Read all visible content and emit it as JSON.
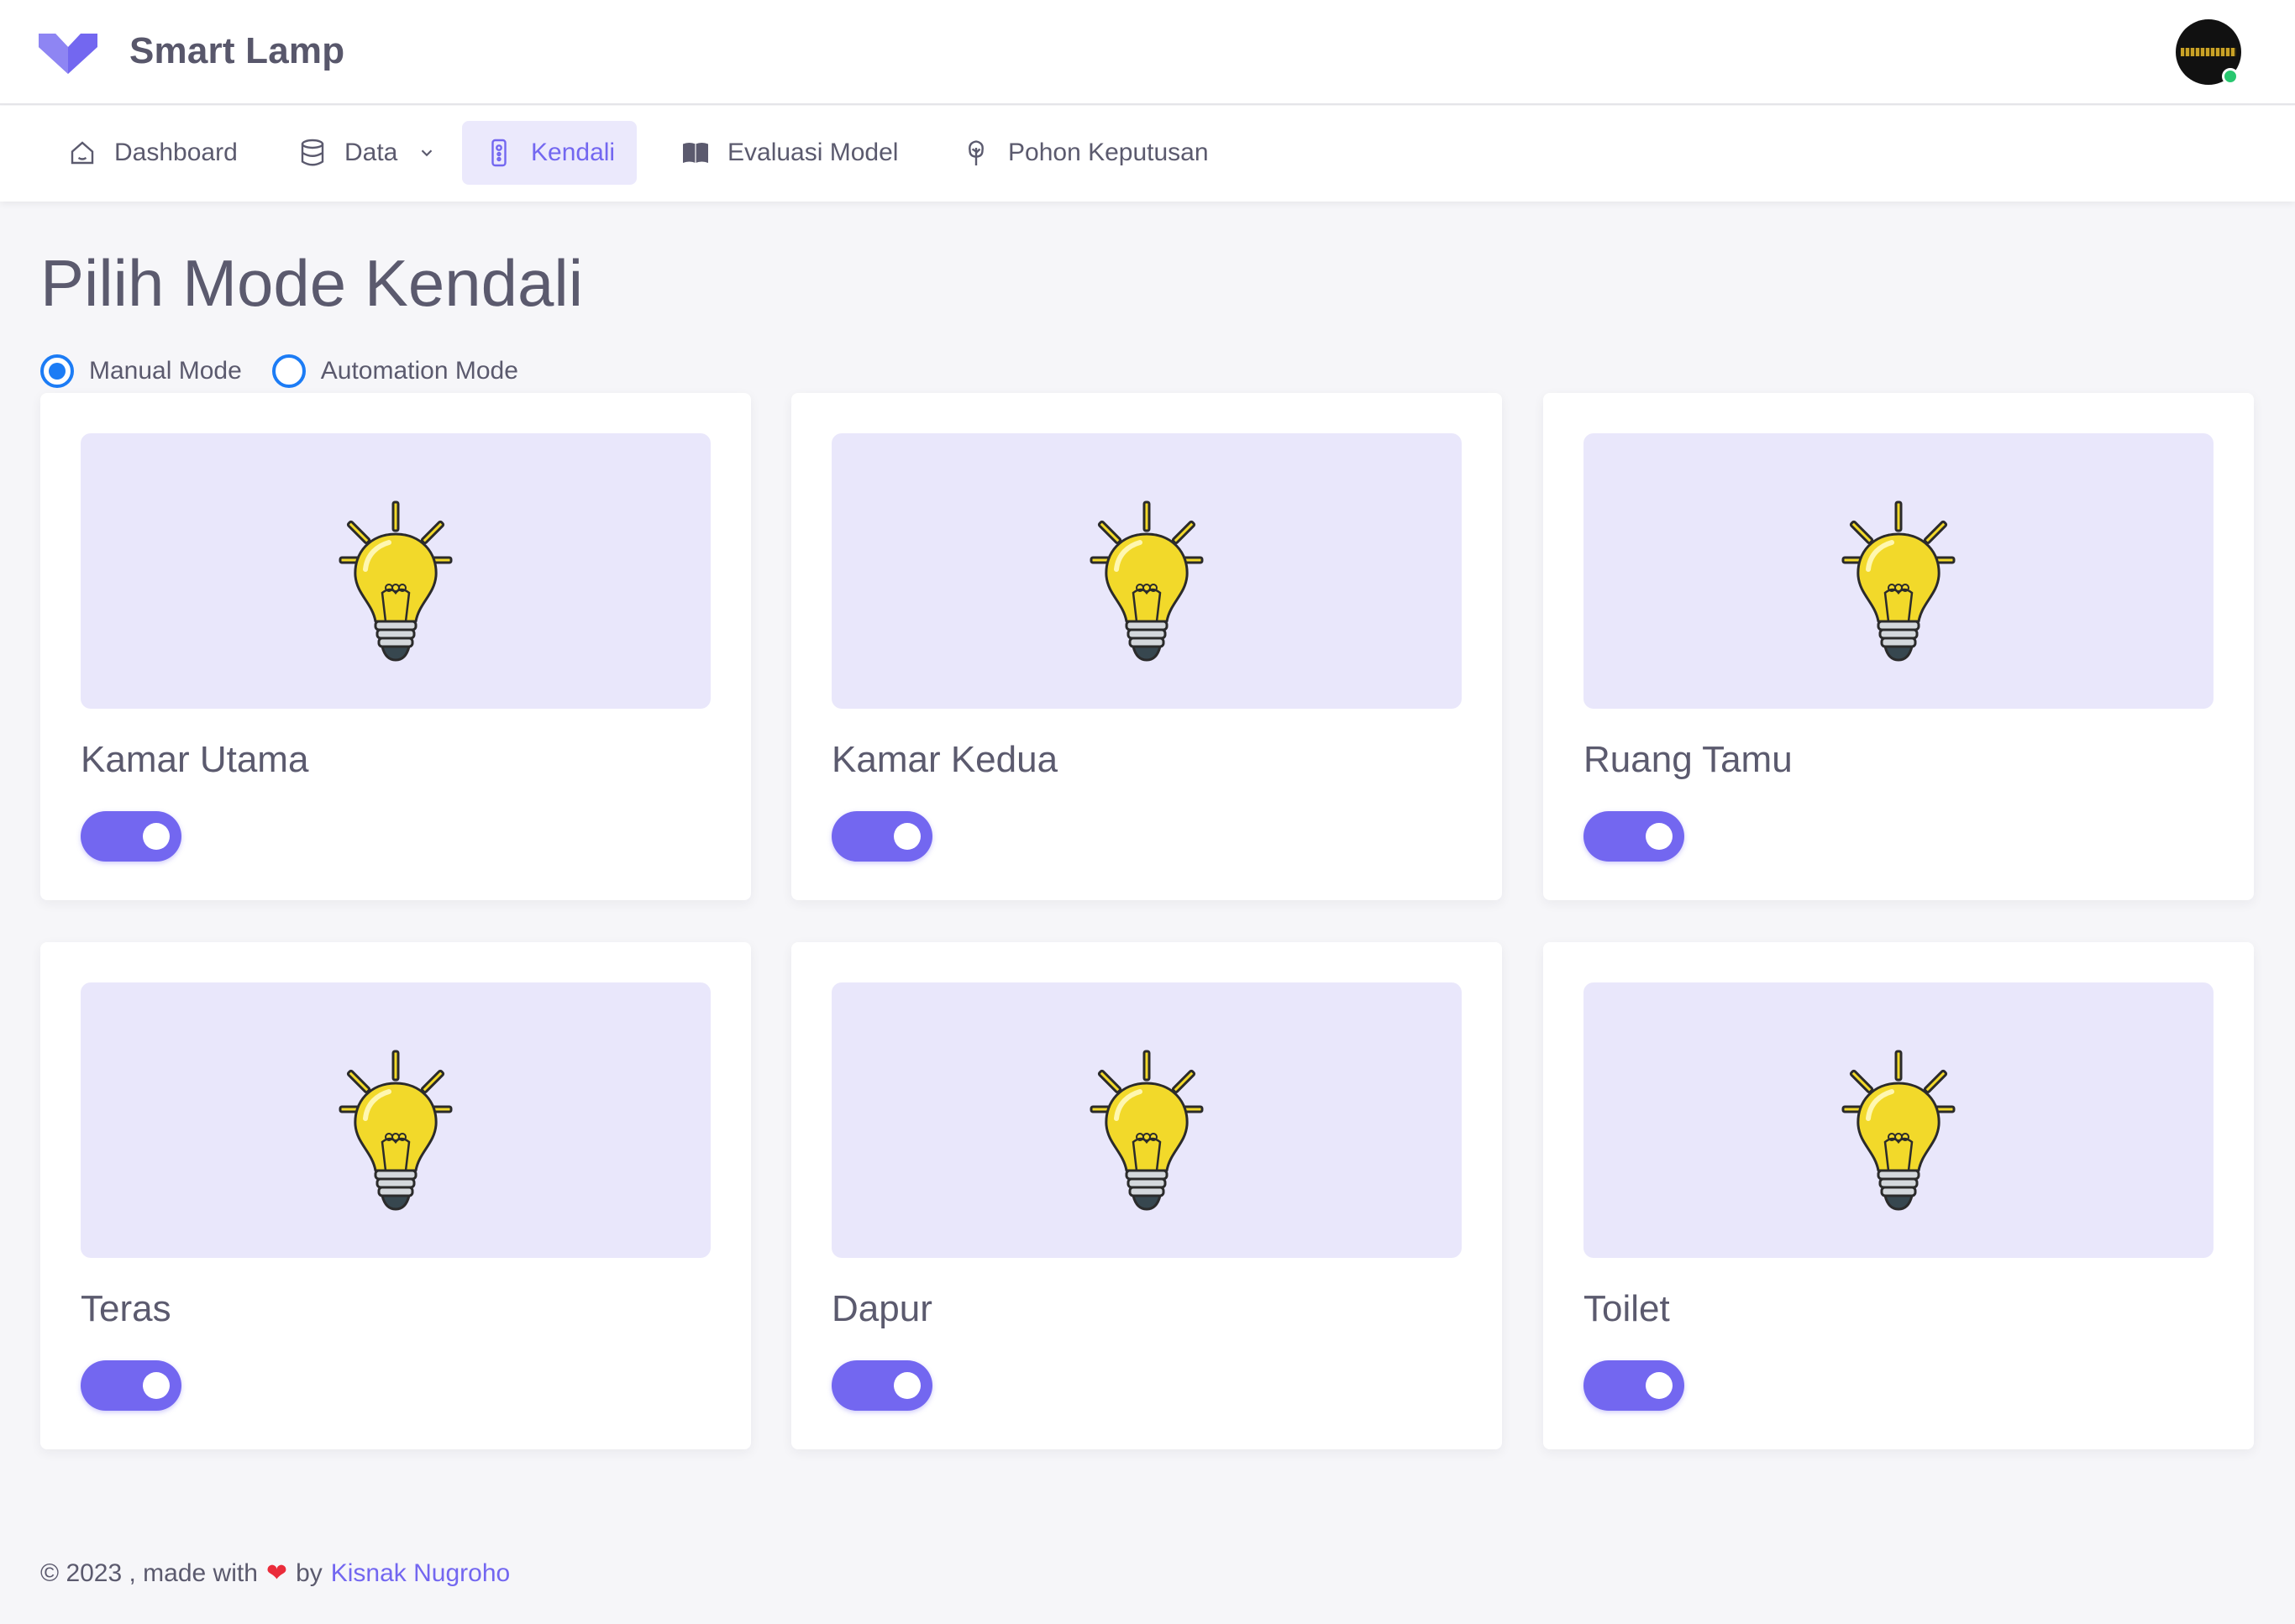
{
  "app": {
    "name": "Smart Lamp"
  },
  "nav": {
    "items": [
      {
        "label": "Dashboard",
        "icon": "home-icon"
      },
      {
        "label": "Data",
        "icon": "database-icon"
      },
      {
        "label": "Kendali",
        "icon": "remote-icon",
        "active": true
      },
      {
        "label": "Evaluasi Model",
        "icon": "book-icon"
      },
      {
        "label": "Pohon Keputusan",
        "icon": "tree-icon"
      }
    ]
  },
  "page": {
    "title": "Pilih Mode Kendali",
    "modes": [
      {
        "label": "Manual Mode",
        "selected": true
      },
      {
        "label": "Automation Mode",
        "selected": false
      }
    ]
  },
  "rooms": [
    {
      "name": "Kamar Utama",
      "on": true
    },
    {
      "name": "Kamar Kedua",
      "on": true
    },
    {
      "name": "Ruang Tamu",
      "on": true
    },
    {
      "name": "Teras",
      "on": true
    },
    {
      "name": "Dapur",
      "on": true
    },
    {
      "name": "Toilet",
      "on": true
    }
  ],
  "footer": {
    "prefix": "© 2023 , made with",
    "by": "by",
    "author": "Kisnak Nugroho"
  },
  "colors": {
    "accent": "#7367f0",
    "radio": "#1c7cf5",
    "online": "#28c76f"
  }
}
